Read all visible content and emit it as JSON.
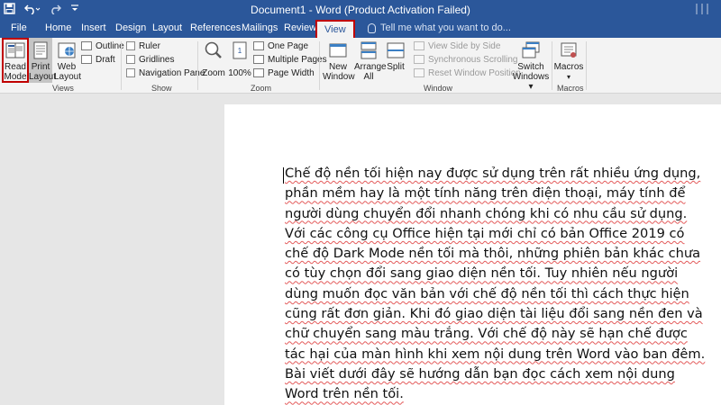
{
  "app": {
    "title": "Document1 - Word (Product Activation Failed)"
  },
  "qat": {
    "save_icon": "save-icon",
    "undo_icon": "undo-icon",
    "redo_icon": "redo-icon",
    "customize_icon": "customize-qat-icon"
  },
  "tabs": [
    "File",
    "Home",
    "Insert",
    "Design",
    "Layout",
    "References",
    "Mailings",
    "Review",
    "View"
  ],
  "active_tab": "View",
  "tell_me": "Tell me what you want to do...",
  "ribbon": {
    "views": {
      "label": "Views",
      "read_mode": [
        "Read",
        "Mode"
      ],
      "print_layout": [
        "Print",
        "Layout"
      ],
      "web_layout": [
        "Web",
        "Layout"
      ],
      "outline": "Outline",
      "draft": "Draft"
    },
    "show": {
      "label": "Show",
      "ruler": "Ruler",
      "gridlines": "Gridlines",
      "navigation_pane": "Navigation Pane"
    },
    "zoom": {
      "label": "Zoom",
      "zoom": "Zoom",
      "percent": "100%",
      "one_page": "One Page",
      "multiple_pages": "Multiple Pages",
      "page_width": "Page Width"
    },
    "window": {
      "label": "Window",
      "new_window": [
        "New",
        "Window"
      ],
      "arrange_all": [
        "Arrange",
        "All"
      ],
      "split": "Split",
      "view_side_by_side": "View Side by Side",
      "sync_scrolling": "Synchronous Scrolling",
      "reset_position": "Reset Window Position",
      "switch_windows": [
        "Switch",
        "Windows ▾"
      ]
    },
    "macros": {
      "label": "Macros",
      "macros": "Macros"
    }
  },
  "document": {
    "lines": [
      "Chế độ nền tối hiện nay được sử dụng trên rất nhiều ứng dụng,",
      "phần mềm hay là một tính năng trên điện thoại, máy tính để",
      "người dùng chuyển đổi nhanh chóng khi có nhu cầu sử dụng.",
      "Với các công cụ Office hiện tại mới chỉ có bản Office 2019 có",
      "chế độ Dark Mode nền tối mà thôi, những phiên bản khác chưa",
      "có tùy chọn đổi sang giao diện nền tối. Tuy nhiên nếu người",
      "dùng muốn đọc văn bản với chế độ nền tối thì cách thực hiện",
      "cũng rất đơn giản. Khi đó giao diện tài liệu đổi sang nền đen và",
      "chữ chuyển sang màu trắng. Với chế độ này sẽ hạn chế được",
      "tác hại của màn hình khi xem nội dung trên Word vào ban đêm.",
      "Bài viết dưới đây sẽ hướng dẫn bạn đọc cách xem nội dung",
      "Word trên nền tối."
    ]
  },
  "colors": {
    "brand": "#2b579a",
    "highlight": "#c00000",
    "ribbon_bg": "#f3f3f3",
    "canvas": "#e6e6e6"
  }
}
